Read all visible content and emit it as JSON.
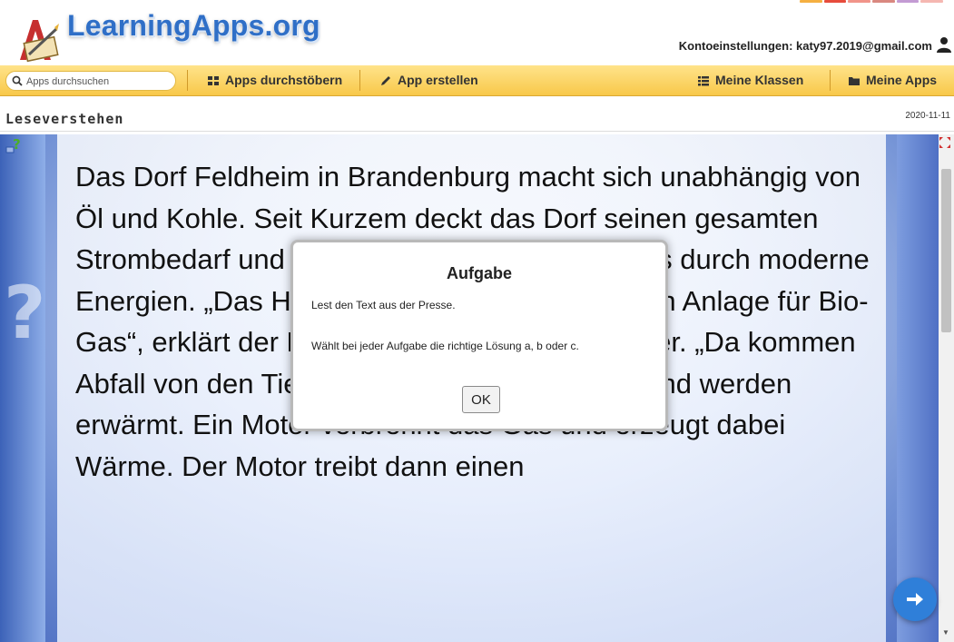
{
  "brand": {
    "name": "LearningApps.org",
    "color": "#2f6fc7"
  },
  "account": {
    "label": "Kontoeinstellungen: katy97.2019@gmail.com",
    "icon": "user-icon"
  },
  "nav": {
    "search_placeholder": "Apps durchsuchen",
    "browse_label": "Apps durchstöbern",
    "create_label": "App erstellen",
    "classes_label": "Meine Klassen",
    "apps_label": "Meine Apps",
    "bar_color": "#f8c84a"
  },
  "page": {
    "title": "Leseverstehen",
    "date": "2020-11-11"
  },
  "reading": {
    "text": "Das Dorf Feldheim in Brandenburg macht sich unabhängig von Öl und Kohle. Seit Kurzem deckt das Dorf seinen gesamten Strombedarf und drei Viertel des Wärmebedarfs durch moderne Energien. „Das Herzstück ist eine der modernen Anlage für Bio-Gas“, erklärt der Diplom-Physiker Eckhard Meier. „Da kommen Abfall von den Tieren, Getreide und Holz rein und werden erwärmt. Ein Motor verbrennt das Gas und erzeugt dabei Wärme. Der Motor treibt dann einen"
  },
  "dialog": {
    "title": "Aufgabe",
    "line1": "Lest den Text aus der Presse.",
    "line2": "Wählt bei jeder Aufgabe die richtige Lösung a, b oder c.",
    "ok_label": "OK"
  },
  "icons": {
    "help": "help-icon",
    "fullscreen": "fullscreen-icon",
    "next": "arrow-right-icon",
    "accent_blue": "#2f7fd9"
  }
}
